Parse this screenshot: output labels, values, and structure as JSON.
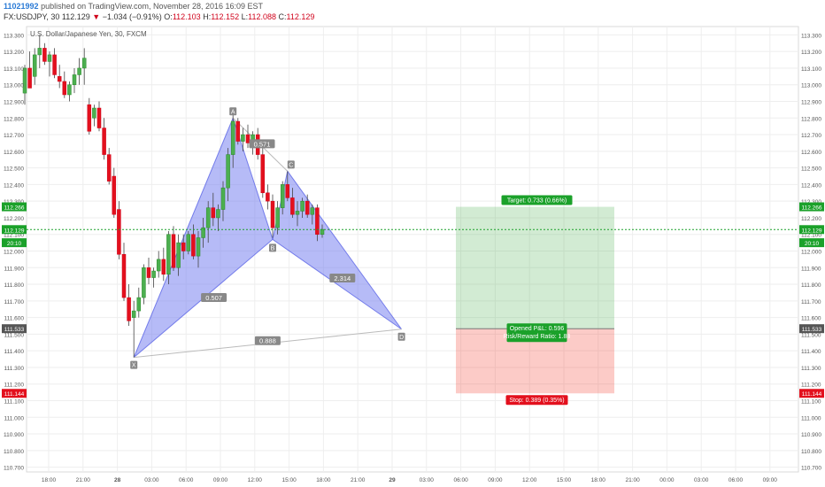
{
  "header": {
    "user_id": "11021992",
    "published": "published on TradingView.com, November 28, 2016 16:09 EST",
    "symbol": "FX:USDJPY, 30",
    "last": "112.129",
    "change_arrow": "▼",
    "change": "−1.034 (−0.91%)",
    "o_label": "O:",
    "o_val": "112.103",
    "h_label": "H:",
    "h_val": "112.152",
    "l_label": "L:",
    "l_val": "112.088",
    "c_label": "C:",
    "c_val": "112.129"
  },
  "chart_data": {
    "type": "candlestick",
    "title": "U.S. Dollar/Japanese Yen, 30, FXCM",
    "ylim": [
      110.65,
      113.35
    ],
    "y_ticks": [
      "113.300",
      "113.200",
      "113.100",
      "113.000",
      "112.900",
      "112.800",
      "112.700",
      "112.600",
      "112.500",
      "112.400",
      "112.300",
      "112.200",
      "112.100",
      "112.000",
      "111.900",
      "111.800",
      "111.700",
      "111.600",
      "111.500",
      "111.400",
      "111.300",
      "111.200",
      "111.100",
      "111.000",
      "110.900",
      "110.800",
      "110.700"
    ],
    "x_ticks": [
      "18:00",
      "21:00",
      "28",
      "03:00",
      "06:00",
      "09:00",
      "12:00",
      "15:00",
      "18:00",
      "21:00",
      "29",
      "03:00",
      "06:00",
      "09:00",
      "12:00",
      "15:00",
      "18:00",
      "21:00",
      "00:00",
      "03:00",
      "06:00",
      "09:00"
    ],
    "price_badges": [
      {
        "label": "112.266",
        "value": 112.266,
        "color": "#1ba12a"
      },
      {
        "label": "112.129",
        "value": 112.129,
        "color": "#1ba12a"
      },
      {
        "label": "20:10",
        "value": 112.05,
        "color": "#1ba12a"
      },
      {
        "label": "111.533",
        "value": 111.533,
        "color": "#555555"
      },
      {
        "label": "111.144",
        "value": 111.144,
        "color": "#e3101d"
      }
    ],
    "current_price": 112.129,
    "candles": [
      [
        112.95,
        113.12,
        112.88,
        113.1
      ],
      [
        113.1,
        113.2,
        113.0,
        112.98
      ],
      [
        113.05,
        113.22,
        113.0,
        113.18
      ],
      [
        113.18,
        113.3,
        113.1,
        113.22
      ],
      [
        113.22,
        113.25,
        113.12,
        113.14
      ],
      [
        113.14,
        113.2,
        113.05,
        113.18
      ],
      [
        113.18,
        113.22,
        113.04,
        113.06
      ],
      [
        113.05,
        113.12,
        112.98,
        113.02
      ],
      [
        113.02,
        113.08,
        112.92,
        112.94
      ],
      [
        112.94,
        113.02,
        112.9,
        113.0
      ],
      [
        113.0,
        113.1,
        112.95,
        113.06
      ],
      [
        113.06,
        113.16,
        113.0,
        113.1
      ],
      [
        113.1,
        113.22,
        113.0,
        113.16
      ],
      [
        112.88,
        112.92,
        112.7,
        112.72
      ],
      [
        112.8,
        112.88,
        112.75,
        112.86
      ],
      [
        112.86,
        112.9,
        112.72,
        112.74
      ],
      [
        112.74,
        112.8,
        112.55,
        112.58
      ],
      [
        112.58,
        112.62,
        112.4,
        112.42
      ],
      [
        112.45,
        112.5,
        112.2,
        112.22
      ],
      [
        112.25,
        112.3,
        111.95,
        111.98
      ],
      [
        111.98,
        112.05,
        111.7,
        111.72
      ],
      [
        111.72,
        111.8,
        111.55,
        111.58
      ],
      [
        111.6,
        111.7,
        111.36,
        111.64
      ],
      [
        111.64,
        111.78,
        111.6,
        111.72
      ],
      [
        111.72,
        111.92,
        111.68,
        111.9
      ],
      [
        111.9,
        111.96,
        111.8,
        111.84
      ],
      [
        111.84,
        111.9,
        111.78,
        111.88
      ],
      [
        111.88,
        112.0,
        111.84,
        111.95
      ],
      [
        111.95,
        112.02,
        111.82,
        111.86
      ],
      [
        111.86,
        112.12,
        111.8,
        112.1
      ],
      [
        112.1,
        112.15,
        111.88,
        111.9
      ],
      [
        111.9,
        112.1,
        111.85,
        112.05
      ],
      [
        112.05,
        112.1,
        111.95,
        112.0
      ],
      [
        112.0,
        112.12,
        111.98,
        112.1
      ],
      [
        112.1,
        112.16,
        111.95,
        111.97
      ],
      [
        111.97,
        112.12,
        111.9,
        112.08
      ],
      [
        112.08,
        112.2,
        112.02,
        112.14
      ],
      [
        112.14,
        112.3,
        112.05,
        112.26
      ],
      [
        112.26,
        112.35,
        112.15,
        112.2
      ],
      [
        112.2,
        112.28,
        112.12,
        112.25
      ],
      [
        112.25,
        112.42,
        112.18,
        112.38
      ],
      [
        112.38,
        112.62,
        112.3,
        112.58
      ],
      [
        112.58,
        112.82,
        112.5,
        112.78
      ],
      [
        112.78,
        112.8,
        112.64,
        112.66
      ],
      [
        112.66,
        112.74,
        112.6,
        112.7
      ],
      [
        112.7,
        112.76,
        112.62,
        112.65
      ],
      [
        112.65,
        112.72,
        112.58,
        112.7
      ],
      [
        112.7,
        112.74,
        112.55,
        112.58
      ],
      [
        112.58,
        112.62,
        112.32,
        112.35
      ],
      [
        112.35,
        112.4,
        112.25,
        112.3
      ],
      [
        112.3,
        112.34,
        112.08,
        112.14
      ],
      [
        112.14,
        112.3,
        112.1,
        112.26
      ],
      [
        112.26,
        112.42,
        112.22,
        112.4
      ],
      [
        112.4,
        112.48,
        112.3,
        112.32
      ],
      [
        112.32,
        112.38,
        112.2,
        112.22
      ],
      [
        112.22,
        112.3,
        112.15,
        112.24
      ],
      [
        112.24,
        112.32,
        112.2,
        112.3
      ],
      [
        112.3,
        112.34,
        112.2,
        112.22
      ],
      [
        112.22,
        112.28,
        112.16,
        112.26
      ],
      [
        112.26,
        112.28,
        112.06,
        112.1
      ],
      [
        112.1,
        112.16,
        112.08,
        112.13
      ]
    ],
    "pattern": {
      "points": [
        {
          "label": "X",
          "index": 22,
          "value": 111.36
        },
        {
          "label": "A",
          "index": 42,
          "value": 112.8
        },
        {
          "label": "B",
          "index": 50,
          "value": 112.07
        },
        {
          "label": "C",
          "index": 53,
          "value": 112.48
        },
        {
          "label": "D",
          "index": 76,
          "value": 111.53
        }
      ],
      "ratios": [
        "0.507",
        "0.571",
        "2.314",
        "0.888"
      ]
    },
    "position": {
      "target_label": "Target: 0.733 (0.66%)",
      "opened_label": "Opened P&L: 0.596",
      "rr_label": "Risk/Reward Ratio: 1.88",
      "stop_label": "Stop: 0.389 (0.35%)",
      "entry": 111.533,
      "target": 112.266,
      "stop": 111.144
    }
  }
}
